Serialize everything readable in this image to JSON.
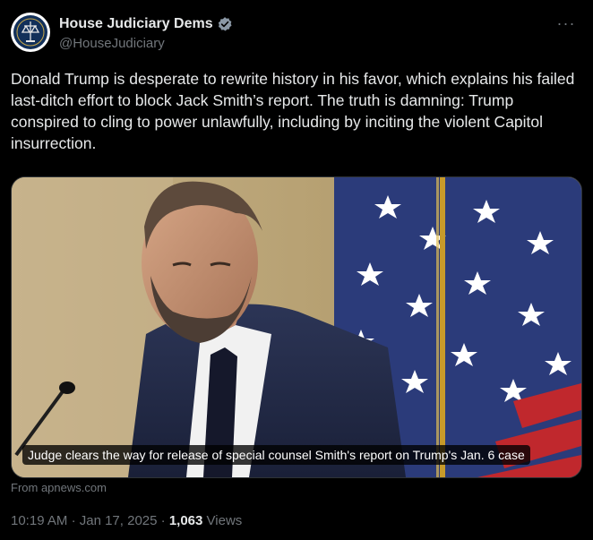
{
  "author": {
    "display_name": "House Judiciary Dems",
    "handle": "@HouseJudiciary",
    "verified": true,
    "verified_color": "#8b98a5"
  },
  "more_icon": "···",
  "tweet": {
    "text": "Donald Trump is desperate to rewrite history in his favor, which explains his failed last-ditch effort to block Jack Smith’s report. The truth is damning: Trump conspired to cling to power unlawfully, including by inciting the violent Capitol insurrection."
  },
  "card": {
    "caption": "Judge clears the way for release of special counsel Smith's report on Trump's Jan. 6 case",
    "source": "From apnews.com"
  },
  "meta": {
    "time": "10:19 AM",
    "separator": "·",
    "date": "Jan 17, 2025",
    "views_count": "1,063",
    "views_label": "Views"
  }
}
